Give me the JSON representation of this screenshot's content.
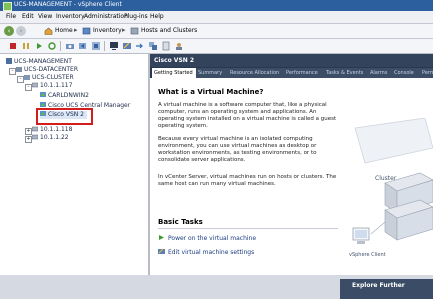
{
  "window": {
    "title": "UCS-MANAGEMENT - vSphere Client"
  },
  "menu": [
    "File",
    "Edit",
    "View",
    "Inventory",
    "Administration",
    "Plug-ins",
    "Help"
  ],
  "nav": {
    "crumbs": [
      "Home",
      "Inventory",
      "Hosts and Clusters"
    ]
  },
  "tree": {
    "root": "UCS-MANAGEMENT",
    "datacenter": "UCS-DATACENTER",
    "cluster": "UCS-CLUSTER",
    "host1": "10.1.1.117",
    "vm_win": "CARLDNWIN2",
    "vm_mgr": "Cisco UCS Central Manager",
    "vm_selected": "Cisco VSN 2",
    "host2": "10.1.1.118",
    "host3": "10.1.1.22"
  },
  "panel": {
    "title": "Cisco VSN 2",
    "tabs": [
      "Getting Started",
      "Summary",
      "Resource Allocation",
      "Performance",
      "Tasks & Events",
      "Alarms",
      "Console",
      "Permissions"
    ],
    "heading": "What is a Virtual Machine?",
    "para1": "A virtual machine is a software computer that, like a physical computer, runs an operating system and applications. An operating system installed on a virtual machine is called a guest operating system.",
    "para2": "Because every virtual machine is an isolated computing environment, you can use virtual machines as desktop or workstation environments, as testing environments, or to consolidate server applications.",
    "para3": "In vCenter Server, virtual machines run on hosts or clusters. The same host can run many virtual machines.",
    "basic_tasks": "Basic Tasks",
    "task_power": "Power on the virtual machine",
    "task_edit": "Edit virtual machine settings",
    "diagram_cluster": "Cluster",
    "diagram_client": "vSphere Client",
    "explore": "Explore Further",
    "close_label": "close tab"
  },
  "colors": {
    "titlebar": "#2c5f9e",
    "panel_header": "#33435b",
    "link": "#1b3c80",
    "highlight": "#d31c1c"
  }
}
